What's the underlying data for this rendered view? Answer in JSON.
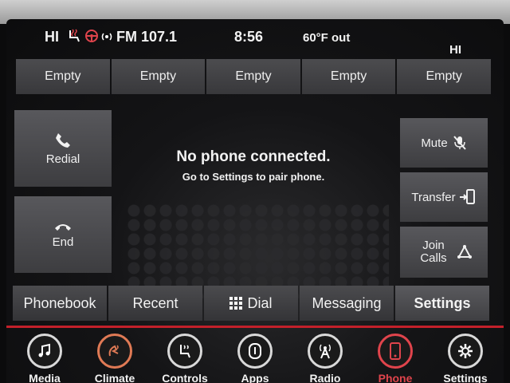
{
  "status": {
    "left_label": "HI",
    "radio": "FM 107.1",
    "time": "8:56",
    "temp": "60°F out",
    "right_label": "HI"
  },
  "presets": [
    "Empty",
    "Empty",
    "Empty",
    "Empty",
    "Empty"
  ],
  "left_buttons": {
    "redial": "Redial",
    "end": "End"
  },
  "right_buttons": {
    "mute": "Mute",
    "transfer": "Transfer",
    "join": "Join Calls"
  },
  "message": {
    "title": "No phone connected.",
    "subtitle": "Go to Settings to pair phone."
  },
  "tabs": [
    "Phonebook",
    "Recent",
    "Dial",
    "Messaging",
    "Settings"
  ],
  "dock": [
    "Media",
    "Climate",
    "Controls",
    "Apps",
    "Radio",
    "Phone",
    "Settings"
  ],
  "colors": {
    "accent": "#c3202a",
    "active_tab": "#e0444c"
  }
}
